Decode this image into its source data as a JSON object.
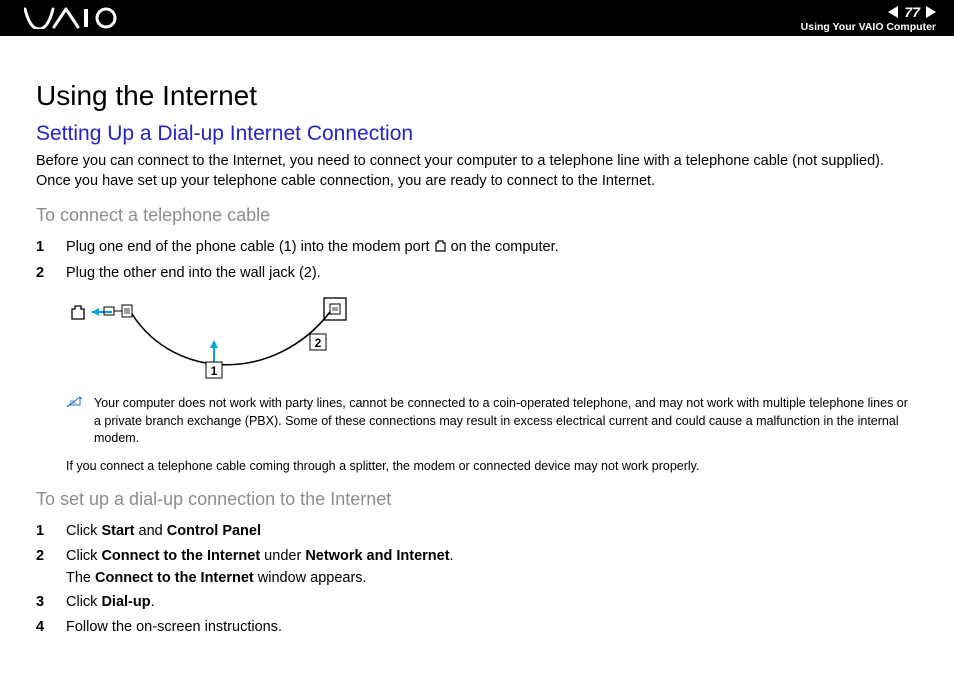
{
  "header": {
    "page_number": "77",
    "section_label": "Using Your VAIO Computer"
  },
  "content": {
    "h1": "Using the Internet",
    "h2": "Setting Up a Dial-up Internet Connection",
    "intro": "Before you can connect to the Internet, you need to connect your computer to a telephone line with a telephone cable (not supplied). Once you have set up your telephone cable connection, you are ready to connect to the Internet.",
    "h3a": "To connect a telephone cable",
    "steps_a": {
      "s1_num": "1",
      "s1_text_before": "Plug one end of the phone cable (1) into the modem port ",
      "s1_text_after": " on the computer.",
      "s2_num": "2",
      "s2_text": "Plug the other end into the wall jack (2)."
    },
    "diagram_labels": {
      "one": "1",
      "two": "2"
    },
    "note1": "Your computer does not work with party lines, cannot be connected to a coin-operated telephone, and may not work with multiple telephone lines or a private branch exchange (PBX). Some of these connections may result in excess electrical current and could cause a malfunction in the internal modem.",
    "note2": "If you connect a telephone cable coming through a splitter, the modem or connected device may not work properly.",
    "h3b": "To set up a dial-up connection to the Internet",
    "steps_b": {
      "s1_num": "1",
      "s1_pre": "Click ",
      "s1_b1": "Start",
      "s1_mid": " and ",
      "s1_b2": "Control Panel",
      "s2_num": "2",
      "s2_pre": "Click ",
      "s2_b1": "Connect to the Internet",
      "s2_mid": " under ",
      "s2_b2": "Network and Internet",
      "s2_end": ".",
      "s2_line2_pre": "The ",
      "s2_line2_b": "Connect to the Internet",
      "s2_line2_end": " window appears.",
      "s3_num": "3",
      "s3_pre": "Click ",
      "s3_b1": "Dial-up",
      "s3_end": ".",
      "s4_num": "4",
      "s4_text": "Follow the on-screen instructions."
    }
  }
}
